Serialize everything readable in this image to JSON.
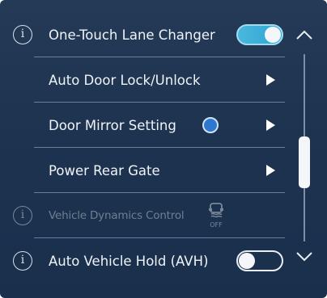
{
  "menu": {
    "items": [
      {
        "label": "One-Touch Lane Changer",
        "info": true,
        "control": "toggle",
        "toggle_state": "on"
      },
      {
        "label": "Auto Door Lock/Unlock",
        "info": false,
        "control": "arrow"
      },
      {
        "label": "Door Mirror Setting",
        "info": false,
        "control": "arrow",
        "indicator": "blue-dot"
      },
      {
        "label": "Power Rear Gate",
        "info": false,
        "control": "arrow"
      },
      {
        "label": "Vehicle Dynamics Control",
        "info": true,
        "control": "icon",
        "disabled": true,
        "icon": "vdc-off-icon",
        "icon_text": "OFF"
      },
      {
        "label": "Auto Vehicle Hold (AVH)",
        "info": true,
        "control": "toggle",
        "toggle_state": "off"
      }
    ],
    "info_glyph": "i"
  },
  "colors": {
    "background": "#1d3350",
    "toggle_on": "#3aaed8",
    "indicator_dot": "#2d78cf",
    "disabled_text": "#6f7e93"
  },
  "scroll": {
    "position_fraction": 0.55
  }
}
